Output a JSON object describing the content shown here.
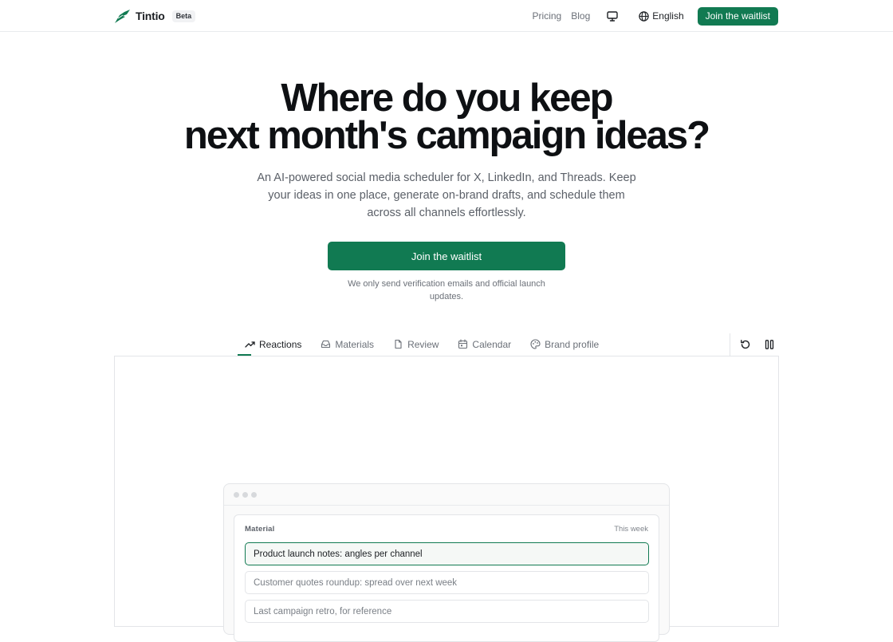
{
  "header": {
    "brand_name": "Tintio",
    "beta_label": "Beta",
    "nav_links": [
      "Pricing",
      "Blog"
    ],
    "theme_icon": "monitor-icon",
    "language": "English",
    "cta": "Join the waitlist"
  },
  "hero": {
    "title_line1": "Where do you keep",
    "title_line2": "next month's campaign ideas?",
    "subtitle": "An AI-powered social media scheduler for X, LinkedIn, and Threads. Keep your ideas in one place, generate on-brand drafts, and schedule them across all channels effortlessly.",
    "cta": "Join the waitlist",
    "note": "We only send verification emails and official launch updates."
  },
  "tabs": [
    {
      "label": "Reactions",
      "icon": "trending-up-icon",
      "active": true
    },
    {
      "label": "Materials",
      "icon": "inbox-icon",
      "active": false
    },
    {
      "label": "Review",
      "icon": "document-icon",
      "active": false
    },
    {
      "label": "Calendar",
      "icon": "calendar-icon",
      "active": false
    },
    {
      "label": "Brand profile",
      "icon": "palette-icon",
      "active": false
    }
  ],
  "tools": {
    "reset_icon": "rotate-ccw-icon",
    "pause_icon": "pause-icon"
  },
  "preview": {
    "card_label": "Material",
    "card_meta": "This week",
    "items": [
      "Product launch notes: angles per channel",
      "Customer quotes roundup: spread over next week",
      "Last campaign retro, for reference"
    ],
    "selected_index": 0
  },
  "colors": {
    "accent": "#117a52",
    "title": "#0e1013",
    "muted": "#6b7078",
    "border": "#e3e5e8"
  }
}
